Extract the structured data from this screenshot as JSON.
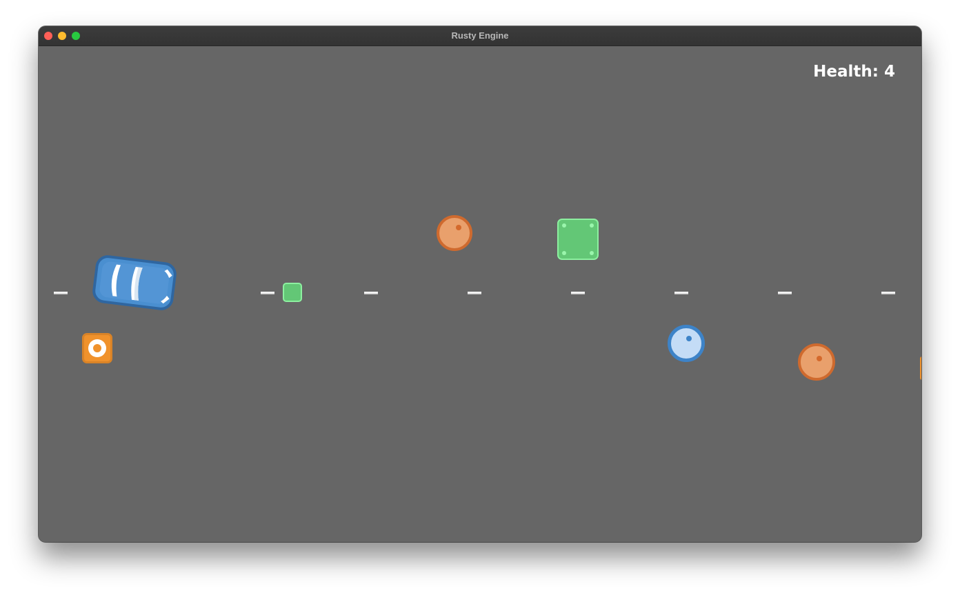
{
  "window": {
    "title": "Rusty Engine"
  },
  "hud": {
    "health_text": "Health: 4",
    "health_value": 4
  },
  "colors": {
    "road": "#666666",
    "car": "#4a8fd0",
    "barrel_orange": "#e9a06c",
    "barrel_blue": "#c4dcf6",
    "crate_green": "#63c776",
    "cone_box": "#f0922c",
    "lane_marker": "#e9e9e9"
  },
  "sprites": [
    {
      "name": "player-car",
      "icon": "blue-car-icon"
    },
    {
      "name": "orange-barrel",
      "icon": "barrel-icon"
    },
    {
      "name": "blue-barrel",
      "icon": "barrel-icon"
    },
    {
      "name": "green-crate",
      "icon": "crate-icon"
    },
    {
      "name": "orange-box",
      "icon": "cone-box-icon"
    }
  ]
}
